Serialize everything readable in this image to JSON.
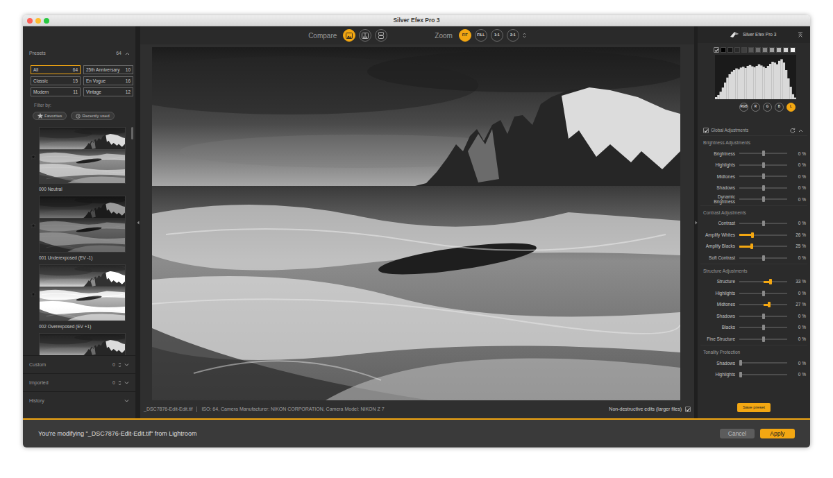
{
  "window": {
    "title": "Silver Efex Pro 3"
  },
  "presets_panel": {
    "title": "Presets",
    "count": "64",
    "expanded": true,
    "filters": [
      {
        "label": "All",
        "count": "64",
        "selected": true
      },
      {
        "label": "25th Anniversary",
        "count": "10",
        "selected": false
      },
      {
        "label": "Classic",
        "count": "15",
        "selected": false
      },
      {
        "label": "En Vogue",
        "count": "16",
        "selected": false
      },
      {
        "label": "Modern",
        "count": "11",
        "selected": false
      },
      {
        "label": "Vintage",
        "count": "12",
        "selected": false
      }
    ],
    "filter_by": "Filter by:",
    "pills": [
      {
        "label": "Favorites",
        "selected": false
      },
      {
        "label": "Recently used",
        "selected": false
      }
    ],
    "presets": [
      {
        "label": "000 Neutral",
        "favorite": true
      },
      {
        "label": "001 Underexposed (EV -1)",
        "favorite": true
      },
      {
        "label": "002 Overexposed (EV +1)",
        "favorite": true
      },
      {
        "partial": true
      }
    ],
    "sections": [
      {
        "label": "Custom",
        "count": "0",
        "expanded": false
      },
      {
        "label": "Imported",
        "count": "0",
        "expanded": false
      },
      {
        "label": "History",
        "expanded": false
      }
    ]
  },
  "toolbar": {
    "compare_label": "Compare",
    "compare_modes": [
      {
        "selected": true
      },
      {
        "selected": false
      },
      {
        "selected": false
      }
    ],
    "zoom_label": "Zoom",
    "zoom_modes": [
      {
        "label": "FIT",
        "selected": true
      },
      {
        "label": "FILL",
        "selected": false
      },
      {
        "label": "1:1",
        "selected": false
      },
      {
        "label": "2:1",
        "selected": false
      }
    ]
  },
  "preview": {
    "file": "_DSC7876-Edit-Edit.tif",
    "meta": "ISO: 64, Camera Manufacturer: NIKON CORPORATION, Camera Model: NIKON Z 7",
    "nondestructive": {
      "label": "Non-destructive edits (larger files)",
      "checked": true
    }
  },
  "adjust_panel": {
    "title": "Silver Efex Pro 3",
    "zones": {
      "checked": true,
      "swatches": [
        {
          "color": "#000000"
        },
        {
          "color": "#141414"
        },
        {
          "color": "#2a2a2a"
        },
        {
          "color": "#404040"
        },
        {
          "color": "#575757"
        },
        {
          "color": "#6e6e6e"
        },
        {
          "color": "#868686"
        },
        {
          "color": "#9e9e9e"
        },
        {
          "color": "#b8b8b8"
        },
        {
          "color": "#d4d4d4"
        },
        {
          "color": "#f2f2f2"
        }
      ]
    },
    "histogram": {
      "values": [
        5,
        10,
        18,
        28,
        40,
        52,
        60,
        66,
        70,
        74,
        72,
        76,
        78,
        75,
        80,
        82,
        79,
        77,
        80,
        84,
        81,
        78,
        75,
        80,
        85,
        90,
        88,
        84,
        92,
        96,
        88,
        70,
        50,
        30,
        12,
        4
      ]
    },
    "channels": [
      {
        "label": "RGB",
        "selected": false
      },
      {
        "label": "R",
        "selected": false
      },
      {
        "label": "G",
        "selected": false
      },
      {
        "label": "B",
        "selected": false
      },
      {
        "label": "L",
        "selected": true
      }
    ],
    "global": {
      "label": "Global Adjustments",
      "checked": true,
      "expanded": true
    },
    "groups": [
      {
        "title": "Brightness Adjustments",
        "rows": [
          {
            "label": "Brightness",
            "reading": "0 %",
            "level": 0.5,
            "kind": "bipolar"
          },
          {
            "label": "Highlights",
            "reading": "0 %",
            "level": 0.5,
            "kind": "bipolar"
          },
          {
            "label": "Midtones",
            "reading": "0 %",
            "level": 0.5,
            "kind": "bipolar"
          },
          {
            "label": "Shadows",
            "reading": "0 %",
            "level": 0.5,
            "kind": "bipolar"
          },
          {
            "label": "Dynamic Brightness",
            "reading": "0 %",
            "level": 0.5,
            "kind": "bipolar"
          }
        ]
      },
      {
        "title": "Contrast Adjustments",
        "rows": [
          {
            "label": "Contrast",
            "reading": "0 %",
            "level": 0.5,
            "kind": "bipolar"
          },
          {
            "label": "Amplify Whites",
            "reading": "26 %",
            "level": 0.26,
            "kind": "unipolar"
          },
          {
            "label": "Amplify Blacks",
            "reading": "25 %",
            "level": 0.25,
            "kind": "unipolar"
          },
          {
            "label": "Soft Contrast",
            "reading": "0 %",
            "level": 0.5,
            "kind": "bipolar"
          }
        ]
      },
      {
        "title": "Structure Adjustments",
        "rows": [
          {
            "label": "Structure",
            "reading": "33 %",
            "level": 0.665,
            "kind": "bipolar"
          },
          {
            "label": "Highlights",
            "reading": "0 %",
            "level": 0.5,
            "kind": "bipolar"
          },
          {
            "label": "Midtones",
            "reading": "27 %",
            "level": 0.635,
            "kind": "bipolar"
          },
          {
            "label": "Shadows",
            "reading": "0 %",
            "level": 0.5,
            "kind": "bipolar"
          },
          {
            "label": "Blacks",
            "reading": "0 %",
            "level": 0.5,
            "kind": "bipolar"
          },
          {
            "label": "Fine Structure",
            "reading": "0 %",
            "level": 0.5,
            "kind": "bipolar"
          }
        ]
      },
      {
        "title": "Tonality Protection",
        "rows": [
          {
            "label": "Shadows",
            "reading": "0 %",
            "level": 0,
            "kind": "unipolar"
          },
          {
            "label": "Highlights",
            "reading": "0 %",
            "level": 0,
            "kind": "unipolar"
          }
        ]
      }
    ],
    "save_button": "Save preset"
  },
  "footer": {
    "message": "You're modifying \"_DSC7876-Edit-Edit.tif\" from Lightroom",
    "buttons": [
      {
        "label": "Cancel",
        "primary": false
      },
      {
        "label": "Apply",
        "primary": true
      }
    ]
  }
}
